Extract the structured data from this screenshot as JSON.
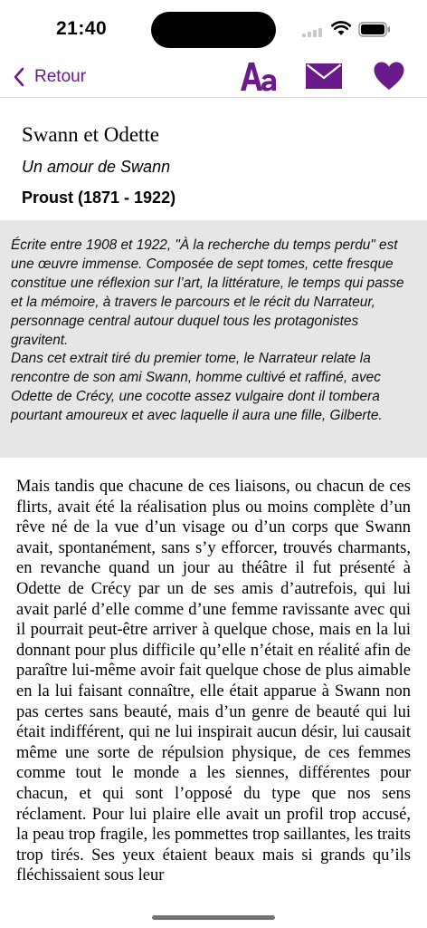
{
  "status_bar": {
    "time": "21:40"
  },
  "nav": {
    "back_label": "Retour",
    "icons": [
      "chevron-left-icon",
      "font-size-icon",
      "mail-icon",
      "heart-icon"
    ],
    "accent_color": "#6b1a8c"
  },
  "header": {
    "title": "Swann et Odette",
    "subtitle": "Un amour de Swann",
    "author": "Proust (1871 - 1922)"
  },
  "intro": {
    "text": "Écrite entre 1908 et 1922, \"À la recherche du temps perdu\" est une œuvre immense. Composée de sept tomes, cette fresque constitue une réflexion sur l’art, la littérature, le temps qui passe et la mémoire, à travers le parcours et le récit du Narrateur, personnage central autour duquel tous les protagonistes gravitent.\nDans cet extrait tiré du premier tome, le Narrateur relate la rencontre de son ami Swann, homme cultivé et raffiné, avec Odette de Crécy, une cocotte assez vulgaire dont il tombera pourtant amoureux et avec laquelle il aura une fille, Gilberte.",
    "background_color": "#e6e6e9"
  },
  "body": {
    "text": "Mais tandis que chacune de ces liaisons, ou chacun de ces flirts, avait été la réalisation plus ou moins complète d’un rêve né de la vue d’un visage ou d’un corps que Swann avait, spontanément, sans s’y efforcer, trouvés charmants, en revanche quand un jour au théâtre il fut présenté à Odette de Crécy par un de ses amis d’autrefois, qui lui avait parlé d’elle comme d’une femme ravissante avec qui il pourrait peut-être arriver à quelque chose, mais en la lui donnant pour plus difficile qu’elle n’était en réalité afin de paraître lui-même avoir fait quelque chose de plus aimable en la lui faisant connaître, elle était apparue à Swann non pas certes sans beauté, mais d’un genre de beauté qui lui était indifférent, qui ne lui inspirait aucun désir, lui causait même une sorte de répulsion physique, de ces femmes comme tout le monde a les siennes, différentes pour chacun, et qui sont l’opposé du type que nos sens réclament. Pour lui plaire elle avait un profil trop accusé, la peau trop fragile, les pommettes trop saillantes, les traits trop tirés. Ses yeux étaient beaux mais si grands qu’ils fléchissaient sous leur"
  }
}
